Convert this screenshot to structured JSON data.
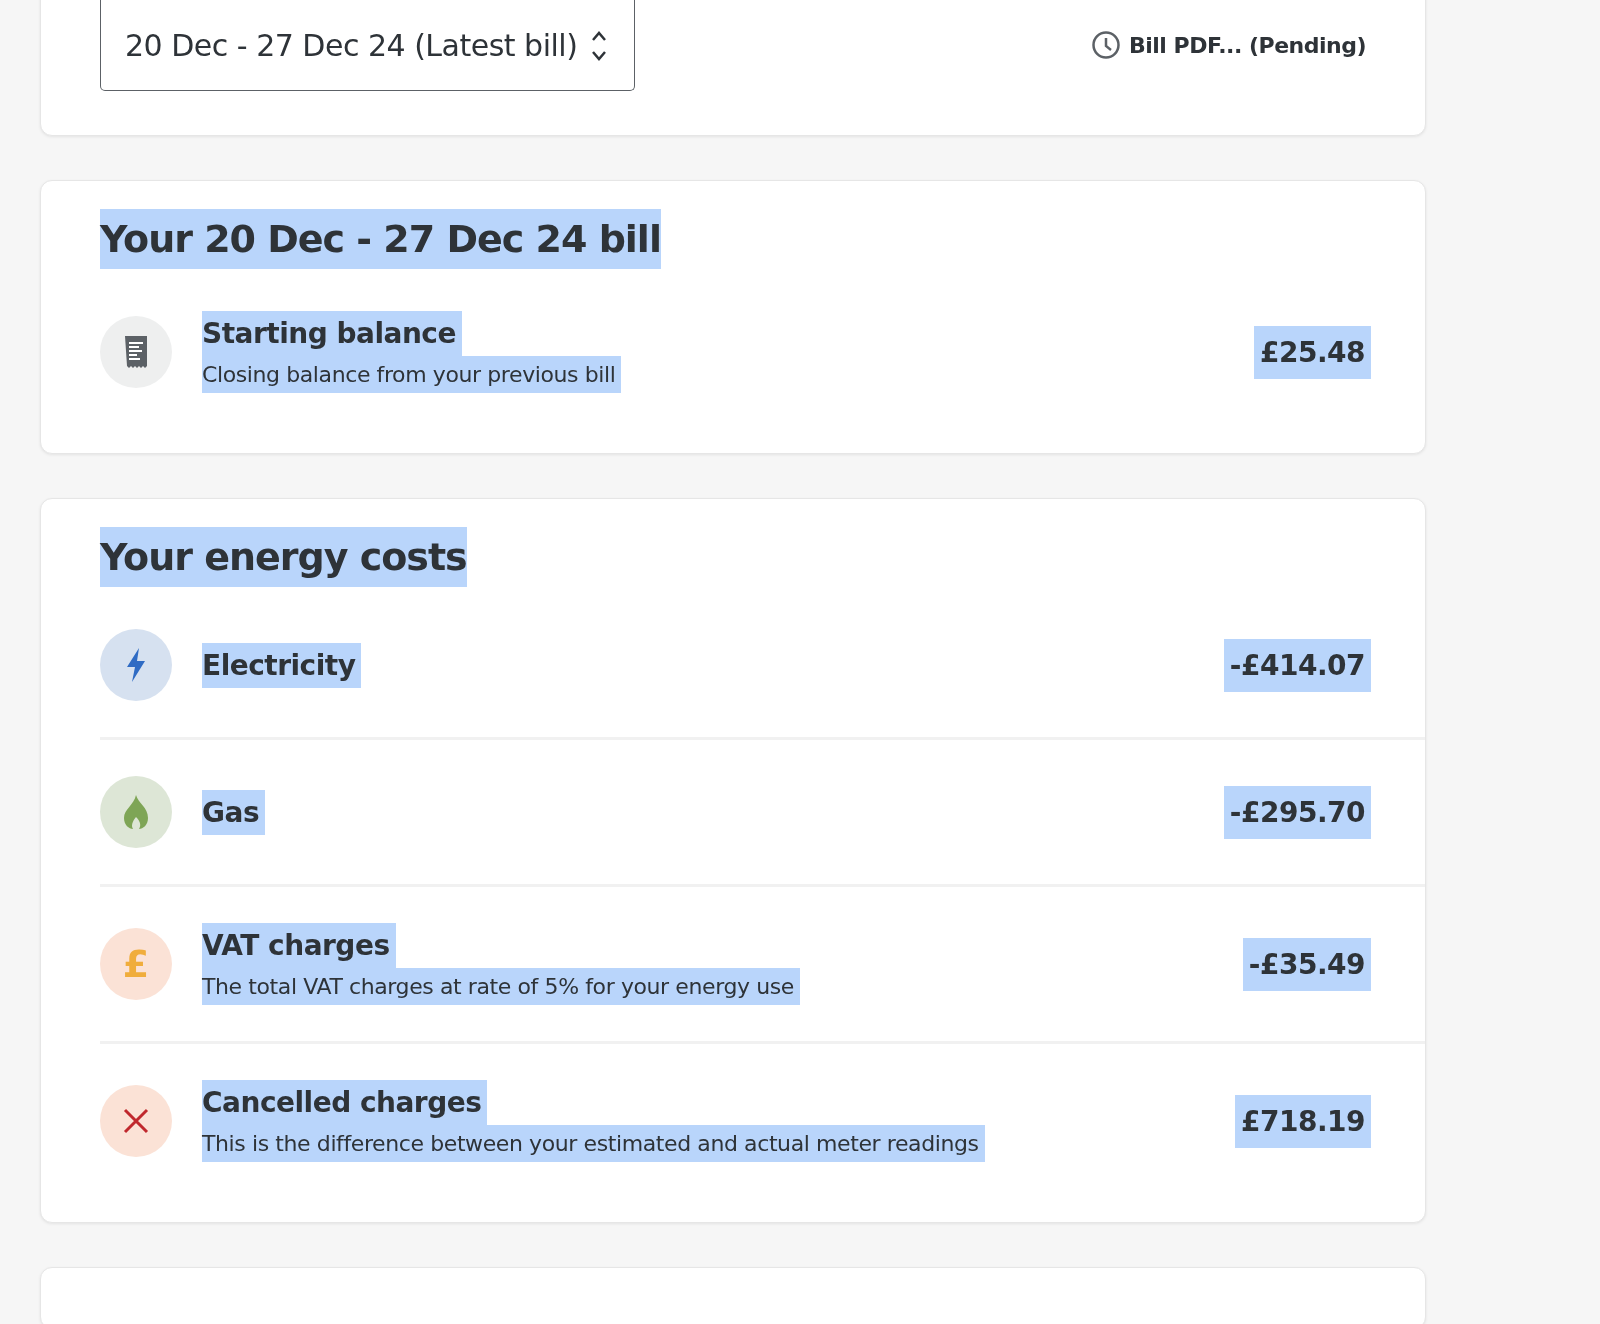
{
  "bill_picker": {
    "value": "20 Dec - 27 Dec 24 (Latest bill)",
    "pdf_link": "Bill PDF... (Pending)"
  },
  "text_selected": true,
  "sections": [
    {
      "heading": "Your 20 Dec - 27 Dec 24 bill",
      "items": [
        {
          "kind": "receipt",
          "label": "Starting balance",
          "description": "Closing balance from your previous bill",
          "amount": "£25.48"
        }
      ]
    },
    {
      "heading": "Your energy costs",
      "items": [
        {
          "kind": "electricity",
          "label": "Electricity",
          "amount": "-£414.07"
        },
        {
          "kind": "gas",
          "label": "Gas",
          "amount": "-£295.70"
        },
        {
          "kind": "vat",
          "icon_text": "£",
          "label": "VAT charges",
          "description": "The total VAT charges at rate of 5% for your energy use",
          "amount": "-£35.49"
        },
        {
          "kind": "cancelled",
          "label": "Cancelled charges",
          "description": "This is the difference between your estimated and actual meter readings",
          "amount": "£718.19"
        }
      ]
    }
  ]
}
